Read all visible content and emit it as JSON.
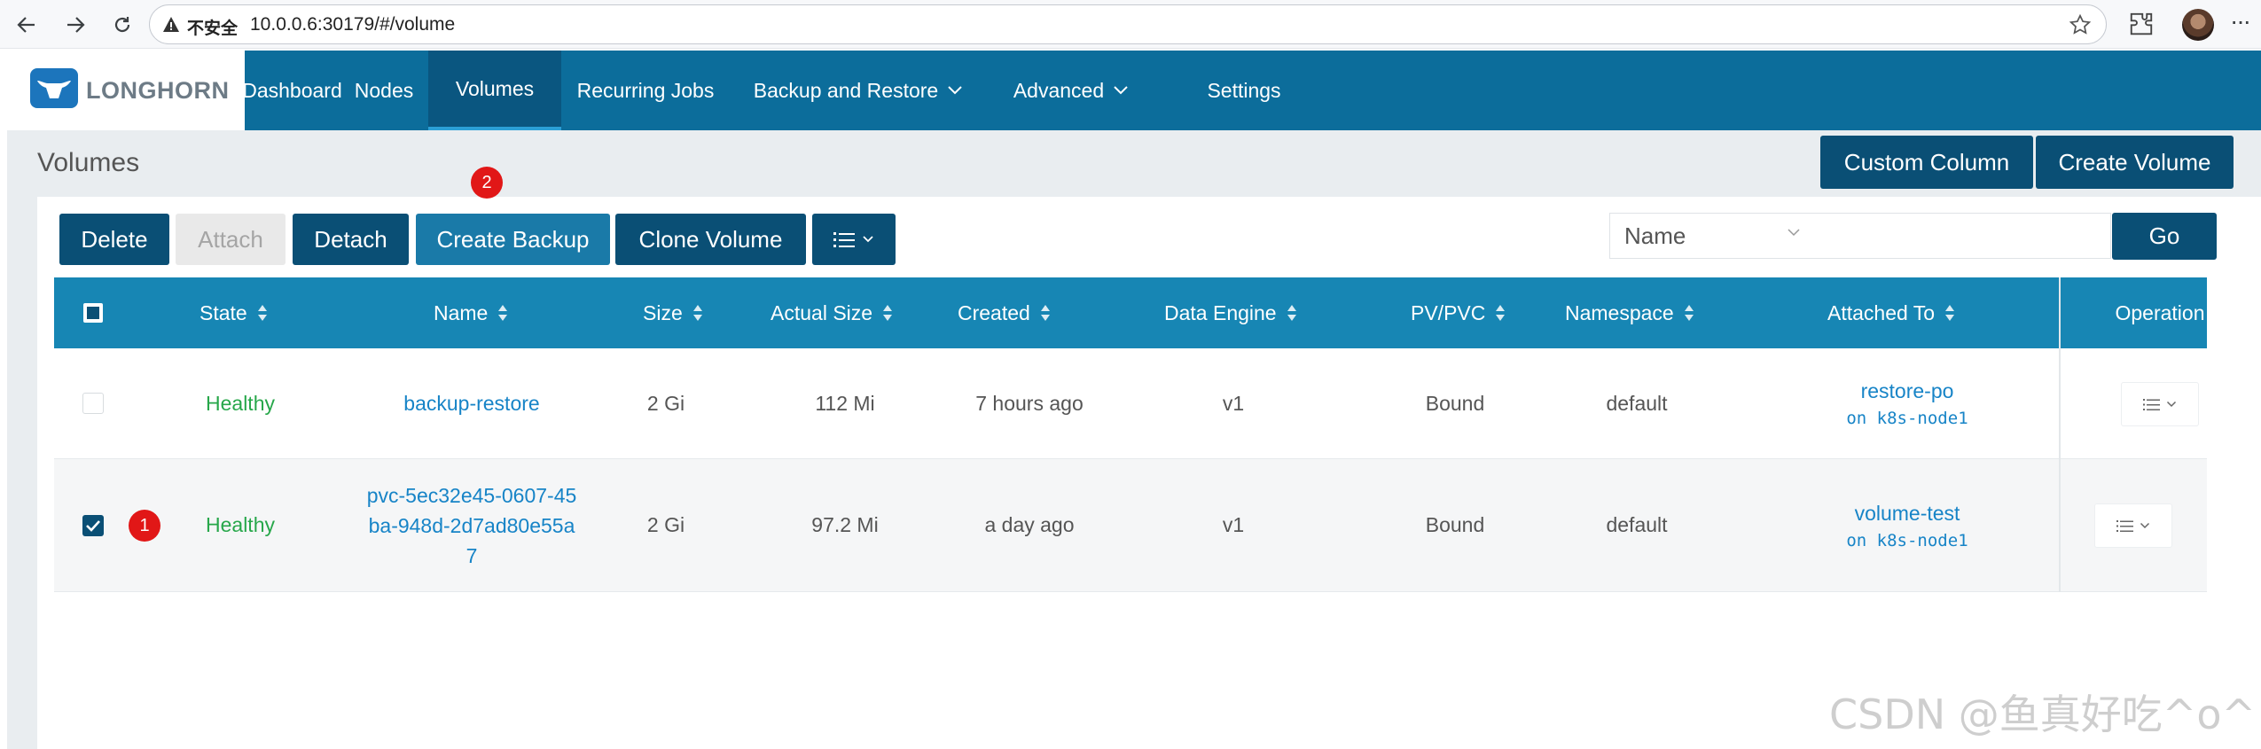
{
  "browser": {
    "security_label": "不安全",
    "url": "10.0.0.6:30179/#/volume"
  },
  "brand": {
    "name": "LONGHORN"
  },
  "nav": [
    {
      "label": "Dashboard"
    },
    {
      "label": "Nodes"
    },
    {
      "label": "Volumes",
      "active": true
    },
    {
      "label": "Recurring Jobs"
    },
    {
      "label": "Backup and Restore",
      "dropdown": true
    },
    {
      "label": "Advanced",
      "dropdown": true
    },
    {
      "label": "Settings"
    }
  ],
  "page": {
    "title": "Volumes",
    "custom_column_label": "Custom Column",
    "create_volume_label": "Create Volume"
  },
  "toolbar": {
    "delete_label": "Delete",
    "attach_label": "Attach",
    "detach_label": "Detach",
    "create_backup_label": "Create Backup",
    "clone_volume_label": "Clone Volume",
    "search_field": "Name",
    "search_value": "",
    "go_label": "Go"
  },
  "annotations": {
    "row_marker": "1",
    "button_marker": "2"
  },
  "table": {
    "headers": {
      "state": "State",
      "name": "Name",
      "size": "Size",
      "actual_size": "Actual Size",
      "created": "Created",
      "data_engine": "Data Engine",
      "pv_pvc": "PV/PVC",
      "namespace": "Namespace",
      "attached_to": "Attached To",
      "operation": "Operation"
    },
    "rows": [
      {
        "checked": false,
        "state": "Healthy",
        "name": "backup-restore",
        "size": "2 Gi",
        "actual_size": "112 Mi",
        "created": "7 hours ago",
        "data_engine": "v1",
        "pv_pvc": "Bound",
        "namespace": "default",
        "attached_pod": "restore-po",
        "attached_node": "on k8s-node1"
      },
      {
        "checked": true,
        "state": "Healthy",
        "name_lines": [
          "pvc-5ec32e45-0607-45",
          "ba-948d-2d7ad80e55a",
          "7"
        ],
        "size": "2 Gi",
        "actual_size": "97.2 Mi",
        "created": "a day ago",
        "data_engine": "v1",
        "pv_pvc": "Bound",
        "namespace": "default",
        "attached_pod": "volume-test",
        "attached_node": "on k8s-node1"
      }
    ]
  },
  "watermark": "CSDN @鱼真好吃^o^",
  "colors": {
    "header_bg": "#0c6d9b",
    "table_header_bg": "#1786b4",
    "primary_button": "#0a4f75",
    "healthy": "#27a74a",
    "link": "#1784c7",
    "annotation_badge": "#e11717"
  }
}
